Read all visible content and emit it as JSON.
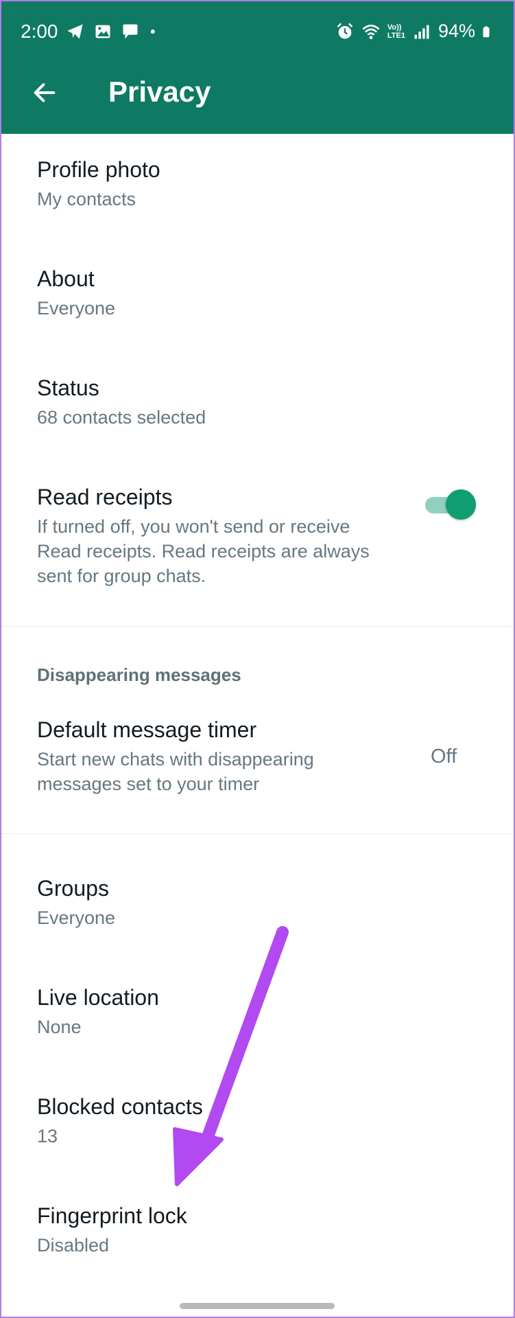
{
  "status_bar": {
    "time": "2:00",
    "battery": "94%",
    "left_icons": [
      "telegram-icon",
      "gallery-icon",
      "chat-icon",
      "dot-icon"
    ],
    "right_icons": [
      "alarm-icon",
      "wifi-icon",
      "volte-icon",
      "signal-icon",
      "battery-icon"
    ],
    "volte_label_top": "Vo))",
    "volte_label_bottom": "LTE1"
  },
  "appbar": {
    "title": "Privacy",
    "back_icon": "arrow-left-icon",
    "color": "#0f7a63"
  },
  "items": {
    "profile_photo": {
      "title": "Profile photo",
      "subtitle": "My contacts"
    },
    "about": {
      "title": "About",
      "subtitle": "Everyone"
    },
    "status": {
      "title": "Status",
      "subtitle": "68 contacts selected"
    },
    "read_receipts": {
      "title": "Read receipts",
      "subtitle_1": "If turned off, you won't send or receive",
      "subtitle_2": "Read receipts. Read receipts are always",
      "subtitle_3": "sent for group chats.",
      "enabled": true
    },
    "disappearing_header": "Disappearing messages",
    "default_timer": {
      "title": "Default message timer",
      "subtitle_1": "Start new chats with disappearing",
      "subtitle_2": "messages set to your timer",
      "value": "Off"
    },
    "groups": {
      "title": "Groups",
      "subtitle": "Everyone"
    },
    "live_location": {
      "title": "Live location",
      "subtitle": "None"
    },
    "blocked_contacts": {
      "title": "Blocked contacts",
      "subtitle": "13"
    },
    "fingerprint_lock": {
      "title": "Fingerprint lock",
      "subtitle": "Disabled"
    }
  },
  "colors": {
    "accent": "#0f9d72",
    "annotation_arrow": "#b14af0",
    "frame": "#b57be8"
  }
}
